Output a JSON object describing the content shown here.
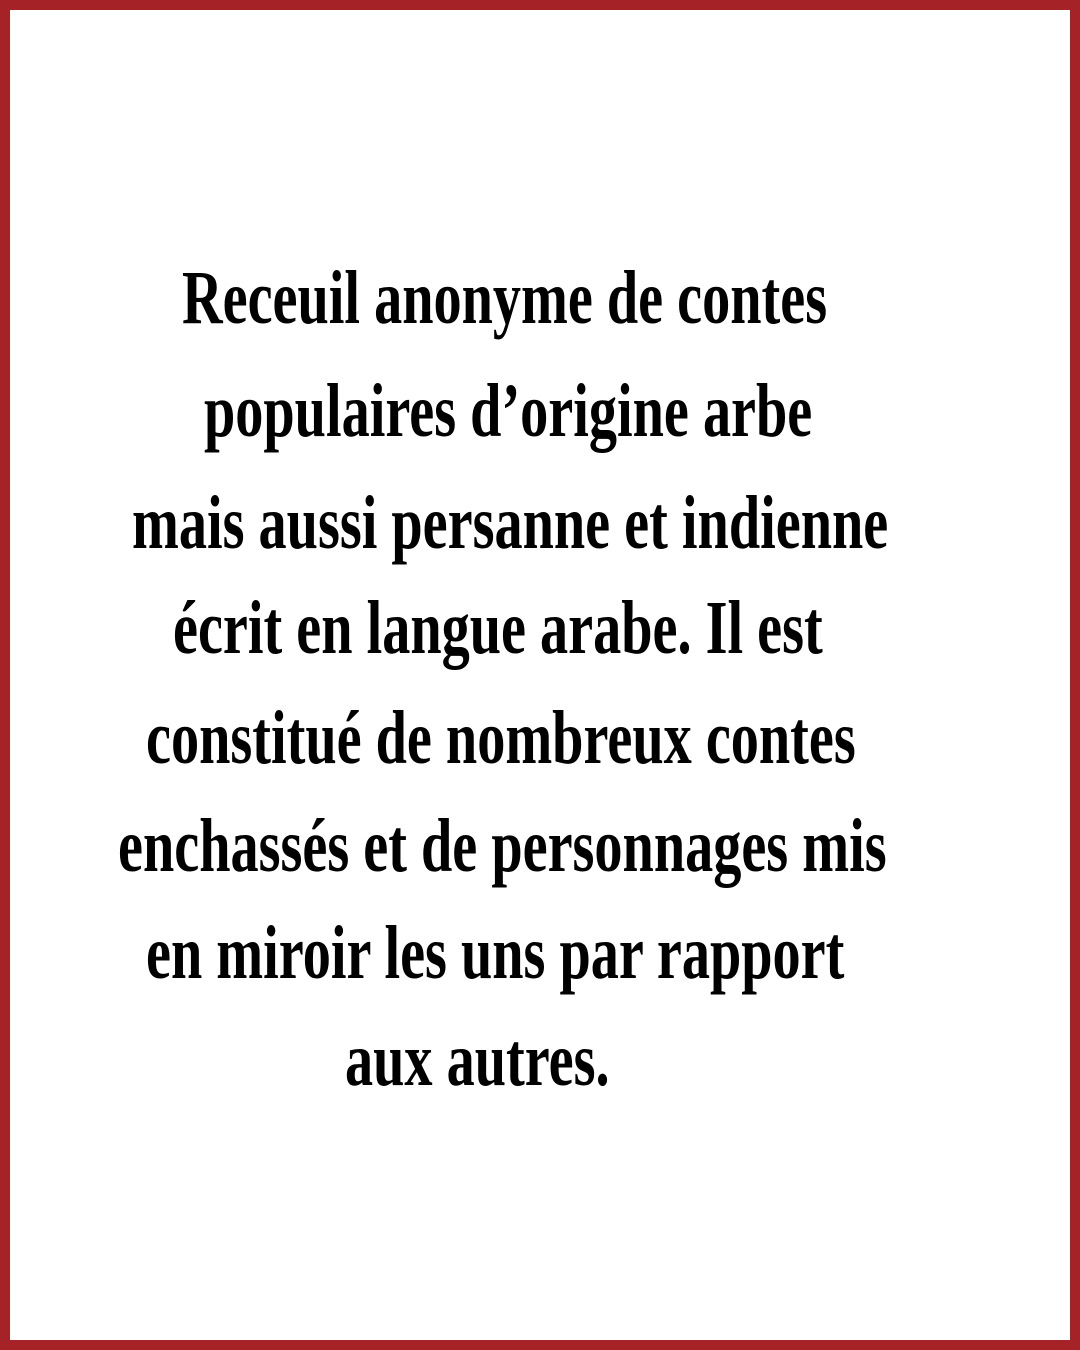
{
  "colors": {
    "border": "#a52227",
    "background": "#ffffff",
    "text": "#000000"
  },
  "paragraph": {
    "lines": [
      "Receuil anonyme de contes",
      "populaires d’origine arbe",
      "mais aussi persanne et indienne",
      "écrit en langue arabe. Il est",
      "constitué de nombreux contes",
      "enchassés et de personnages mis",
      "en miroir les uns par rapport",
      "aux autres."
    ]
  }
}
